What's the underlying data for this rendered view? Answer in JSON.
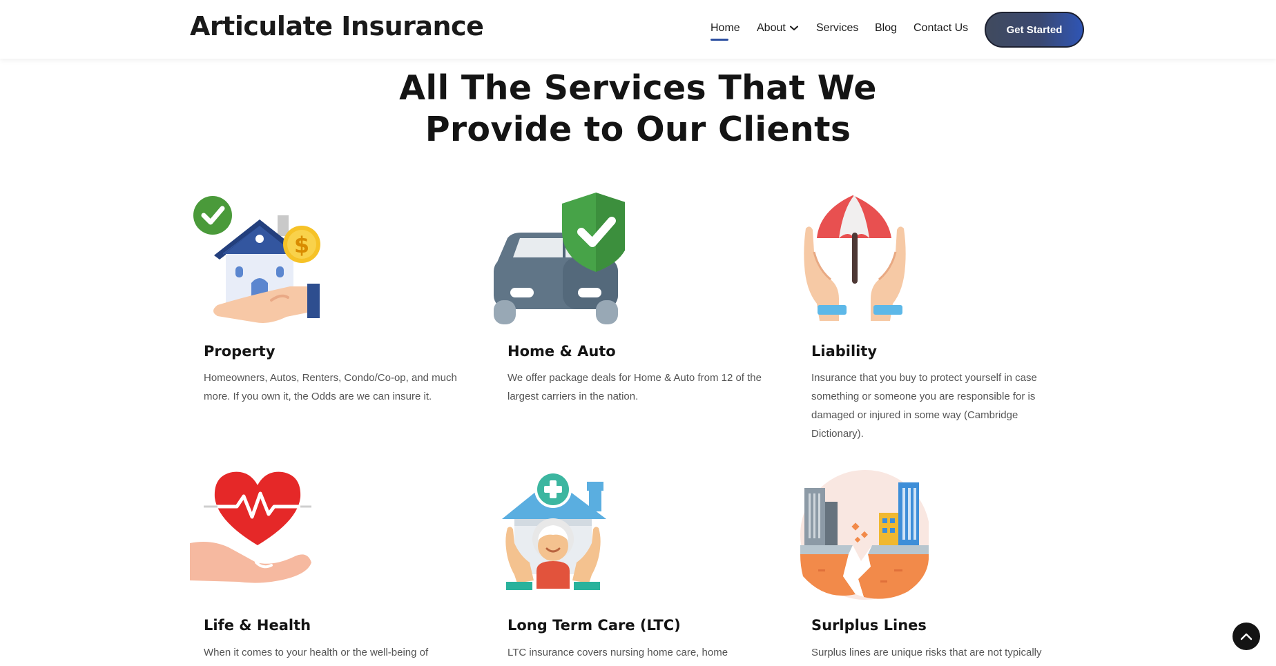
{
  "header": {
    "logo": "Articulate Insurance",
    "nav": [
      {
        "label": "Home"
      },
      {
        "label": "About"
      },
      {
        "label": "Services"
      },
      {
        "label": "Blog"
      },
      {
        "label": "Contact Us"
      }
    ],
    "cta_label": "Get Started",
    "accent_color": "#2c4fa0"
  },
  "section": {
    "title_line1": "All The Services That We",
    "title_line2": "Provide to Our Clients"
  },
  "services": [
    {
      "title": "Property",
      "icon": "house-in-hand-icon",
      "description": "Homeowners, Autos, Renters, Condo/Co-op, and much more. If you own it, the Odds are we can insure it."
    },
    {
      "title": "Home & Auto",
      "icon": "car-shield-icon",
      "description": "We offer package deals for Home & Auto from 12 of the largest carriers in the nation."
    },
    {
      "title": "Liability",
      "icon": "umbrella-hands-icon",
      "description": "Insurance that you buy to protect yourself in case something or someone you are responsible for is damaged or injured in some way (Cambridge Dictionary)."
    },
    {
      "title": "Life & Health",
      "icon": "heart-in-hand-icon",
      "description": "When it comes to your health or the well-being of"
    },
    {
      "title": "Long Term Care (LTC)",
      "icon": "elder-care-home-icon",
      "description": "LTC insurance covers nursing home care, home"
    },
    {
      "title": "Surlplus Lines",
      "icon": "earthquake-city-icon",
      "description": "Surplus lines are unique risks that are not typically"
    }
  ],
  "scroll_top_icon": "arrow-up-icon"
}
